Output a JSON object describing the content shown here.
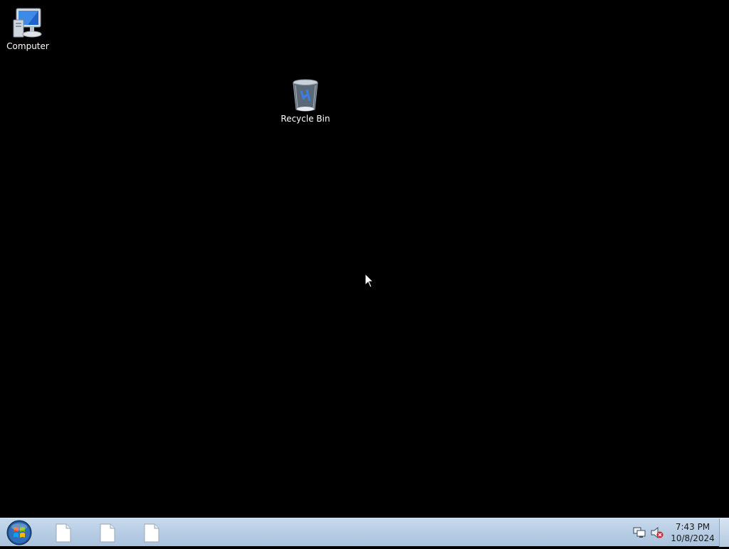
{
  "desktop": {
    "icons": [
      {
        "label": "Computer",
        "icon": "computer-icon"
      },
      {
        "label": "Recycle Bin",
        "icon": "recycle-bin-icon"
      }
    ]
  },
  "taskbar": {
    "start_icon": "windows-start-orb-icon",
    "items": [
      {
        "icon": "document-icon"
      },
      {
        "icon": "document-icon"
      },
      {
        "icon": "document-icon"
      }
    ],
    "tray": {
      "network_icon": "network-icon",
      "volume_icon": "volume-muted-icon"
    },
    "clock": {
      "time": "7:43 PM",
      "date": "10/8/2024"
    }
  },
  "colors": {
    "desktop_background": "#000000",
    "taskbar_top": "#c7d9ec",
    "taskbar_bottom": "#a9c2dd"
  }
}
